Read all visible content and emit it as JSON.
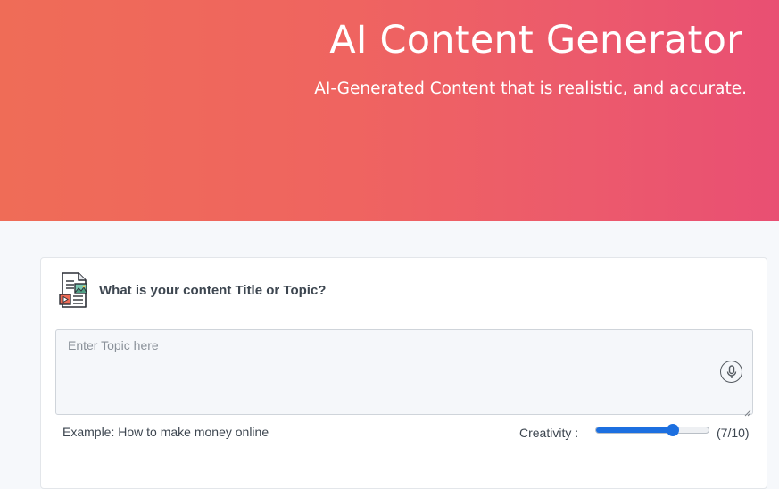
{
  "header": {
    "title": "AI Content Generator",
    "subtitle": "AI-Generated Content that is realistic, and accurate."
  },
  "form": {
    "icon": "document-media-icon",
    "question": "What is your content Title or Topic?",
    "topic_placeholder": "Enter Topic here",
    "topic_value": "",
    "mic_icon": "microphone-icon",
    "example": "Example: How to make money online",
    "creativity_label": "Creativity :",
    "creativity_value_text": "(7/10)",
    "creativity_level": 7,
    "creativity_max": 10
  },
  "colors": {
    "hero_gradient_start": "#ef6c57",
    "hero_gradient_end": "#e94f73",
    "slider_accent": "#1c6fe0"
  }
}
